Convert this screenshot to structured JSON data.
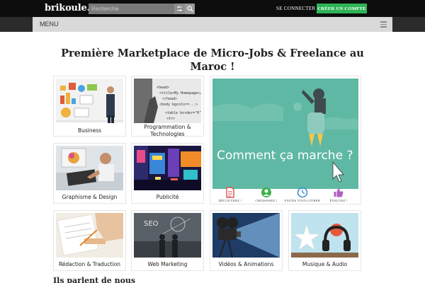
{
  "header": {
    "logo": "brikoule.",
    "search": {
      "placeholder": "Recherche",
      "value": ""
    },
    "connect_label": "SE CONNECTER",
    "create_label": "CRÉER UN COMPTE"
  },
  "menu": {
    "label": "MENU"
  },
  "title": "Première Marketplace de Micro-Jobs & Freelance au Maroc !",
  "categories": [
    {
      "label": "Business"
    },
    {
      "label_line1": "Programmation &",
      "label_line2": "Technologies"
    },
    {
      "label": "Graphisme & Design"
    },
    {
      "label": "Publicité"
    },
    {
      "label": "Rédaction & Traduction"
    },
    {
      "label": "Web Marketing"
    },
    {
      "label": "Vidéos & Animations"
    },
    {
      "label": "Musique & Audio"
    }
  ],
  "promo": {
    "headline": "Comment ça marche ?",
    "steps": [
      {
        "label": "DÉCOUVREZ !",
        "icon": "document-icon",
        "color": "#d9534f"
      },
      {
        "label": "CHOISISSEZ !",
        "icon": "user-check-icon",
        "color": "#3bb34a"
      },
      {
        "label": "FAITES VOUS LIVRER",
        "icon": "clock-icon",
        "color": "#3a8fd0"
      },
      {
        "label": "ÉVALUEZ !",
        "icon": "thumbs-up-icon",
        "color": "#b35dc2"
      }
    ]
  },
  "testimonials": {
    "heading": "Ils parlent de nous"
  },
  "colors": {
    "topbar": "#0d0d0d",
    "accent_green": "#2eb356",
    "menubar": "#d9d9d9",
    "promo_bg": "#5fb8a4"
  }
}
